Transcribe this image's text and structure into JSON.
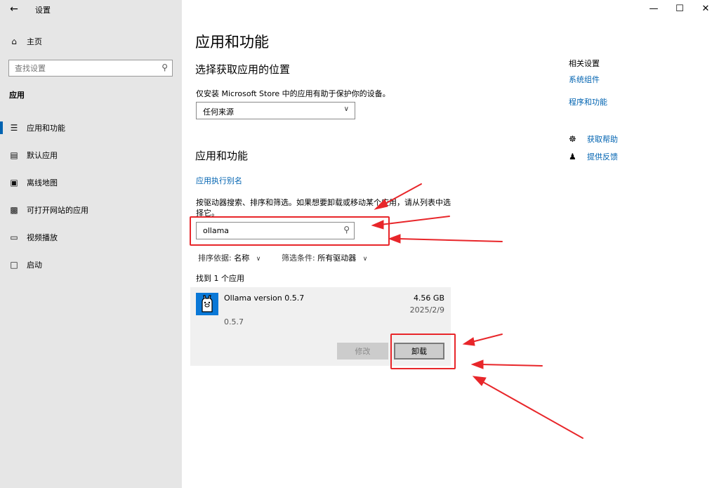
{
  "window": {
    "title": "设置",
    "back_icon": "arrow-left-icon",
    "controls": [
      "minimize-icon",
      "maximize-icon",
      "close-icon"
    ]
  },
  "sidebar": {
    "home_label": "主页",
    "search_placeholder": "查找设置",
    "section_title": "应用",
    "items": [
      {
        "label": "应用和功能",
        "icon": "list-icon",
        "active": true
      },
      {
        "label": "默认应用",
        "icon": "default-apps-icon",
        "active": false
      },
      {
        "label": "离线地图",
        "icon": "map-icon",
        "active": false
      },
      {
        "label": "可打开网站的应用",
        "icon": "web-app-icon",
        "active": false
      },
      {
        "label": "视频播放",
        "icon": "video-icon",
        "active": false
      },
      {
        "label": "启动",
        "icon": "startup-icon",
        "active": false
      }
    ]
  },
  "main": {
    "page_title": "应用和功能",
    "source_section": {
      "heading": "选择获取应用的位置",
      "description": "仅安装 Microsoft Store 中的应用有助于保护你的设备。",
      "dropdown_value": "任何来源"
    },
    "apps_section": {
      "heading": "应用和功能",
      "alias_link": "应用执行别名",
      "search_hint": "按驱动器搜索、排序和筛选。如果想要卸载或移动某个应用，请从列表中选择它。",
      "search_value": "ollama",
      "sort_label": "排序依据:",
      "sort_value": "名称",
      "filter_label": "筛选条件:",
      "filter_value": "所有驱动器",
      "found_text": "找到 1 个应用",
      "apps": [
        {
          "name": "Ollama version 0.5.7",
          "size": "4.56 GB",
          "date": "2025/2/9",
          "version": "0.5.7",
          "modify_label": "修改",
          "uninstall_label": "卸载"
        }
      ]
    }
  },
  "related": {
    "title": "相关设置",
    "links": [
      "系统组件",
      "程序和功能"
    ],
    "help": [
      {
        "label": "获取帮助",
        "icon": "help-chat-icon"
      },
      {
        "label": "提供反馈",
        "icon": "feedback-icon"
      }
    ]
  },
  "colors": {
    "accent": "#0063b1",
    "annotation": "#e8262a",
    "sidebar_bg": "#e6e6e6",
    "app_icon_bg": "#0a78d7"
  }
}
